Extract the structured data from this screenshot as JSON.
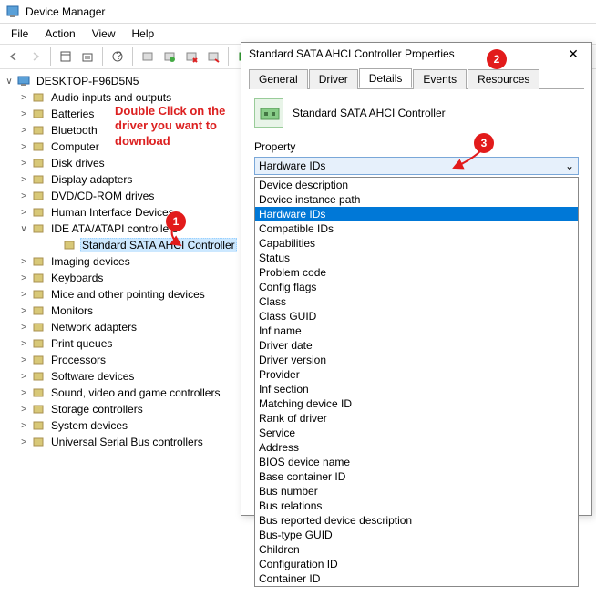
{
  "window": {
    "title": "Device Manager"
  },
  "menu": {
    "file": "File",
    "action": "Action",
    "view": "View",
    "help": "Help"
  },
  "tree": {
    "root": "DESKTOP-F96D5N5",
    "nodes": [
      "Audio inputs and outputs",
      "Batteries",
      "Bluetooth",
      "Computer",
      "Disk drives",
      "Display adapters",
      "DVD/CD-ROM drives",
      "Human Interface Devices",
      "IDE ATA/ATAPI controllers",
      "Standard SATA AHCI Controller",
      "Imaging devices",
      "Keyboards",
      "Mice and other pointing devices",
      "Monitors",
      "Network adapters",
      "Print queues",
      "Processors",
      "Software devices",
      "Sound, video and game controllers",
      "Storage controllers",
      "System devices",
      "Universal Serial Bus controllers"
    ]
  },
  "dialog": {
    "title": "Standard SATA AHCI Controller Properties",
    "tabs": [
      "General",
      "Driver",
      "Details",
      "Events",
      "Resources"
    ],
    "device_name": "Standard SATA AHCI Controller",
    "property_label": "Property",
    "selected_property": "Hardware IDs",
    "dropdown": [
      "Device description",
      "Device instance path",
      "Hardware IDs",
      "Compatible IDs",
      "Capabilities",
      "Status",
      "Problem code",
      "Config flags",
      "Class",
      "Class GUID",
      "Inf name",
      "Driver date",
      "Driver version",
      "Provider",
      "Inf section",
      "Matching device ID",
      "Rank of driver",
      "Service",
      "Address",
      "BIOS device name",
      "Base container ID",
      "Bus number",
      "Bus relations",
      "Bus reported device description",
      "Bus-type GUID",
      "Children",
      "Configuration ID",
      "Container ID"
    ]
  },
  "annotations": {
    "hint": "Double Click on the driver you want to download",
    "b1": "1",
    "b2": "2",
    "b3": "3"
  }
}
